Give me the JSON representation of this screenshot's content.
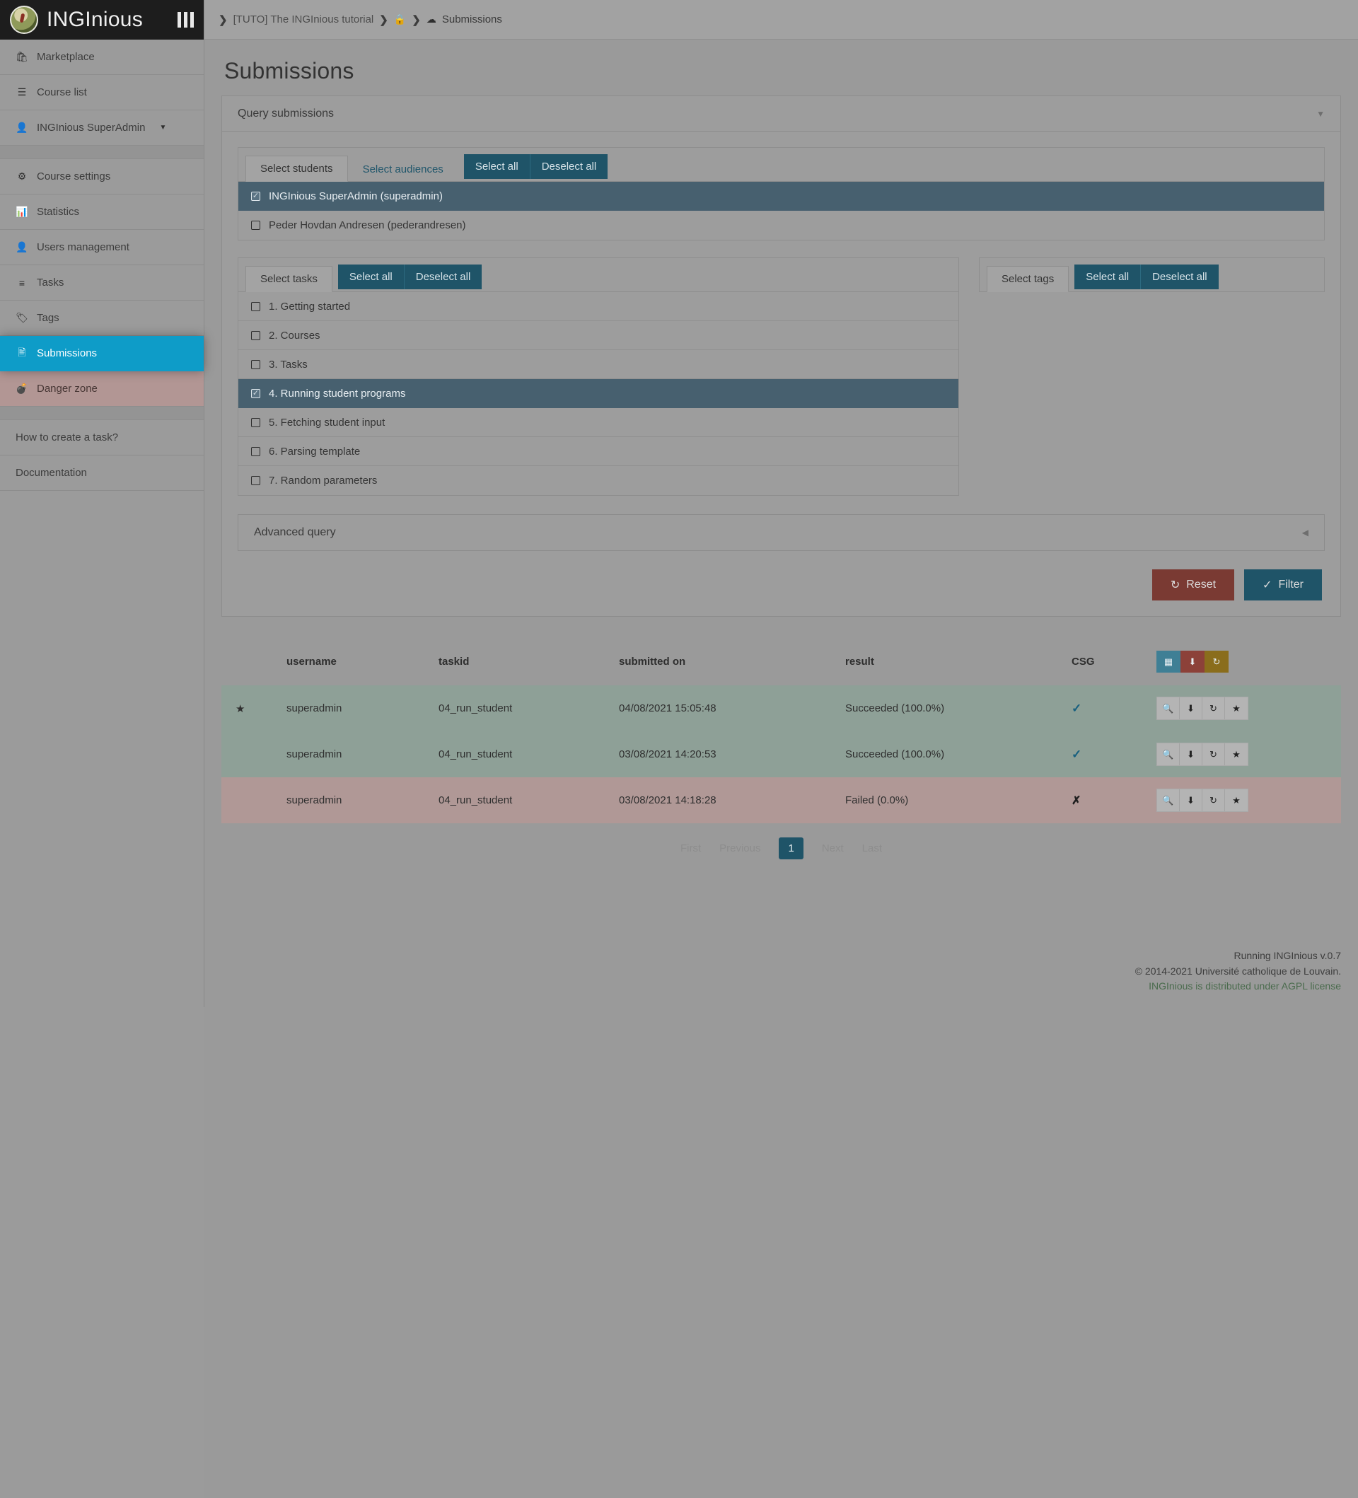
{
  "brand": {
    "name": "INGInious",
    "menu_icon": "hamburger-bars-icon"
  },
  "sidebar": {
    "items": [
      {
        "label": "Marketplace",
        "icon": "shop-icon",
        "state": "normal"
      },
      {
        "label": "Course list",
        "icon": "list-icon",
        "state": "normal"
      },
      {
        "label": "INGInious SuperAdmin",
        "icon": "user-icon",
        "state": "dropdown"
      }
    ],
    "course_items": [
      {
        "label": "Course settings",
        "icon": "gear-icon",
        "state": "normal"
      },
      {
        "label": "Statistics",
        "icon": "chart-icon",
        "state": "normal"
      },
      {
        "label": "Users management",
        "icon": "user-icon",
        "state": "normal"
      },
      {
        "label": "Tasks",
        "icon": "tasks-icon",
        "state": "normal"
      },
      {
        "label": "Tags",
        "icon": "tag-icon",
        "state": "normal"
      },
      {
        "label": "Submissions",
        "icon": "file-code-icon",
        "state": "active"
      },
      {
        "label": "Danger zone",
        "icon": "bomb-icon",
        "state": "danger"
      }
    ],
    "help_items": [
      {
        "label": "How to create a task?"
      },
      {
        "label": "Documentation"
      }
    ]
  },
  "breadcrumb": {
    "course": "[TUTO] The INGInious tutorial",
    "admin_icon": "lock-admin-icon",
    "page_icon": "cloud-download-icon",
    "page": "Submissions"
  },
  "page": {
    "title": "Submissions"
  },
  "query_panel": {
    "title": "Query submissions",
    "collapse_icon": "chevron-down-icon"
  },
  "students_panel": {
    "tabs": [
      {
        "label": "Select students",
        "active": true
      },
      {
        "label": "Select audiences",
        "active": false
      }
    ],
    "select_all": "Select all",
    "deselect_all": "Deselect all",
    "rows": [
      {
        "label": "INGInious SuperAdmin (superadmin)",
        "checked": true
      },
      {
        "label": "Peder Hovdan Andresen (pederandresen)",
        "checked": false
      }
    ]
  },
  "tasks_panel": {
    "tab": "Select tasks",
    "select_all": "Select all",
    "deselect_all": "Deselect all",
    "rows": [
      {
        "label": "1. Getting started",
        "checked": false
      },
      {
        "label": "2. Courses",
        "checked": false
      },
      {
        "label": "3. Tasks",
        "checked": false
      },
      {
        "label": "4. Running student programs",
        "checked": true
      },
      {
        "label": "5. Fetching student input",
        "checked": false
      },
      {
        "label": "6. Parsing template",
        "checked": false
      },
      {
        "label": "7. Random parameters",
        "checked": false
      }
    ]
  },
  "tags_panel": {
    "tab": "Select tags",
    "select_all": "Select all",
    "deselect_all": "Deselect all",
    "rows": []
  },
  "advanced_query": {
    "title": "Advanced query",
    "collapse_icon": "chevron-left-icon"
  },
  "form_actions": {
    "reset": "Reset",
    "reset_icon": "undo-icon",
    "filter": "Filter",
    "filter_icon": "check-icon"
  },
  "results": {
    "columns": [
      "",
      "username",
      "taskid",
      "submitted on",
      "result",
      "CSG",
      ""
    ],
    "header_tools": [
      {
        "name": "table-view-button",
        "icon": "table-icon",
        "color": "#3f7f95"
      },
      {
        "name": "download-all-button",
        "icon": "download-icon",
        "color": "#8c4139"
      },
      {
        "name": "refresh-all-button",
        "icon": "refresh-icon",
        "color": "#8a6d1c"
      }
    ],
    "row_tools": [
      {
        "name": "view-submission-button",
        "icon": "magnifier-icon"
      },
      {
        "name": "download-submission-button",
        "icon": "download-icon"
      },
      {
        "name": "replay-submission-button",
        "icon": "refresh-icon"
      },
      {
        "name": "set-best-submission-button",
        "icon": "star-icon"
      }
    ],
    "rows": [
      {
        "starred": true,
        "username": "superadmin",
        "taskid": "04_run_student",
        "submitted_on": "04/08/2021 15:05:48",
        "result": "Succeeded (100.0%)",
        "csg": "check",
        "status": "ok"
      },
      {
        "starred": false,
        "username": "superadmin",
        "taskid": "04_run_student",
        "submitted_on": "03/08/2021 14:20:53",
        "result": "Succeeded (100.0%)",
        "csg": "check",
        "status": "ok"
      },
      {
        "starred": false,
        "username": "superadmin",
        "taskid": "04_run_student",
        "submitted_on": "03/08/2021 14:18:28",
        "result": "Failed (0.0%)",
        "csg": "cross",
        "status": "bad"
      }
    ]
  },
  "pagination": {
    "first": "First",
    "previous": "Previous",
    "current": "1",
    "next": "Next",
    "last": "Last"
  },
  "footer": {
    "version": "Running INGInious v.0.7",
    "copyright": "© 2014-2021 Université catholique de Louvain.",
    "license": "INGInious is distributed under AGPL license"
  },
  "colors": {
    "accent_active": "#0e9cc8",
    "teal": "#1f5468",
    "danger": "#7a3a33",
    "selected_row": "#47606f",
    "success_row": "#8ea097",
    "fail_row": "#b09896",
    "license_green": "#4a6b4d"
  }
}
